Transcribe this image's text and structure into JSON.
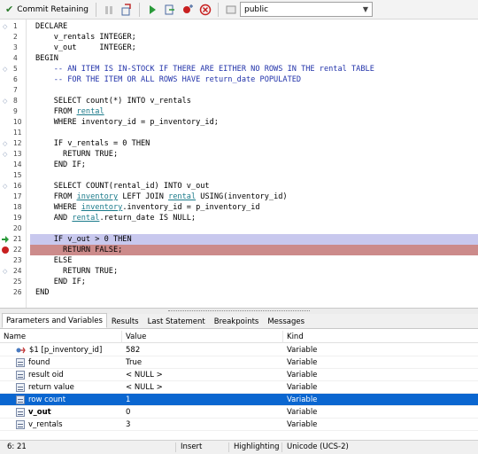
{
  "toolbar": {
    "commit_label": "Commit Retaining",
    "schema_value": "public"
  },
  "editor": {
    "lines": [
      {
        "n": "1",
        "text": "DECLARE"
      },
      {
        "n": "2",
        "text": "    v_rentals INTEGER;"
      },
      {
        "n": "3",
        "text": "    v_out     INTEGER;"
      },
      {
        "n": "4",
        "text": "BEGIN"
      },
      {
        "n": "5",
        "text": "    -- AN ITEM IS IN-STOCK IF THERE ARE EITHER NO ROWS IN THE rental TABLE"
      },
      {
        "n": "6",
        "text": "    -- FOR THE ITEM OR ALL ROWS HAVE return_date POPULATED"
      },
      {
        "n": "7",
        "text": ""
      },
      {
        "n": "8",
        "text": "    SELECT count(*) INTO v_rentals"
      },
      {
        "n": "9",
        "text": "    FROM rental"
      },
      {
        "n": "10",
        "text": "    WHERE inventory_id = p_inventory_id;"
      },
      {
        "n": "11",
        "text": ""
      },
      {
        "n": "12",
        "text": "    IF v_rentals = 0 THEN"
      },
      {
        "n": "13",
        "text": "      RETURN TRUE;"
      },
      {
        "n": "14",
        "text": "    END IF;"
      },
      {
        "n": "15",
        "text": ""
      },
      {
        "n": "16",
        "text": "    SELECT COUNT(rental_id) INTO v_out"
      },
      {
        "n": "17",
        "text": "    FROM inventory LEFT JOIN rental USING(inventory_id)"
      },
      {
        "n": "18",
        "text": "    WHERE inventory.inventory_id = p_inventory_id"
      },
      {
        "n": "19",
        "text": "    AND rental.return_date IS NULL;"
      },
      {
        "n": "20",
        "text": ""
      },
      {
        "n": "21",
        "text": "    IF v_out > 0 THEN"
      },
      {
        "n": "22",
        "text": "      RETURN FALSE;"
      },
      {
        "n": "23",
        "text": "    ELSE"
      },
      {
        "n": "24",
        "text": "      RETURN TRUE;"
      },
      {
        "n": "25",
        "text": "    END IF;"
      },
      {
        "n": "26",
        "text": "END"
      }
    ]
  },
  "tabs": [
    "Parameters and Variables",
    "Results",
    "Last Statement",
    "Breakpoints",
    "Messages"
  ],
  "grid": {
    "headers": {
      "name": "Name",
      "value": "Value",
      "kind": "Kind"
    },
    "rows": [
      {
        "name": "$1 [p_inventory_id]",
        "value": "582",
        "kind": "Variable"
      },
      {
        "name": "found",
        "value": "True",
        "kind": "Variable"
      },
      {
        "name": "result oid",
        "value": "< NULL >",
        "kind": "Variable"
      },
      {
        "name": "return value",
        "value": "< NULL >",
        "kind": "Variable"
      },
      {
        "name": "row count",
        "value": "1",
        "kind": "Variable"
      },
      {
        "name": "v_out",
        "value": "0",
        "kind": "Variable"
      },
      {
        "name": "v_rentals",
        "value": "3",
        "kind": "Variable"
      }
    ]
  },
  "status": {
    "position": "6:  21",
    "mode": "Insert",
    "highlighting": "Highlighting",
    "encoding": "Unicode (UCS-2)"
  },
  "colors": {
    "current_line": "#c8c8ee",
    "breakpoint_line": "#cc8b8b",
    "selection": "#0a66d0",
    "comment": "#2233aa",
    "link": "#1a7a8a"
  }
}
